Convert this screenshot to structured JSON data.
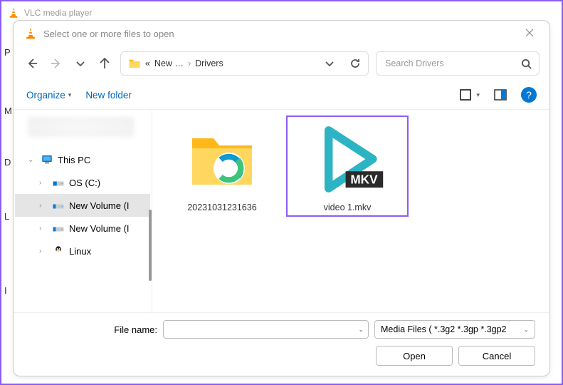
{
  "window": {
    "title": "VLC media player"
  },
  "dialog": {
    "title": "Select one or more files to open",
    "breadcrumb": {
      "prefix": "«",
      "part1": "New …",
      "part2": "Drivers"
    },
    "search": {
      "placeholder": "Search Drivers"
    },
    "toolbar": {
      "organize": "Organize",
      "newfolder": "New folder"
    },
    "tree": {
      "thispc": "This PC",
      "os": "OS (C:)",
      "vol1": "New Volume (I",
      "vol2": "New Volume (I",
      "linux": "Linux"
    },
    "files": {
      "folder_name": "20231031231636",
      "video_name": "video 1.mkv",
      "mkv_label": "MKV"
    },
    "footer": {
      "filename_label": "File name:",
      "filetype": "Media Files ( *.3g2 *.3gp *.3gp2",
      "open": "Open",
      "cancel": "Cancel"
    }
  },
  "bg_letters": [
    "P",
    "M",
    "D",
    "L",
    "I"
  ]
}
